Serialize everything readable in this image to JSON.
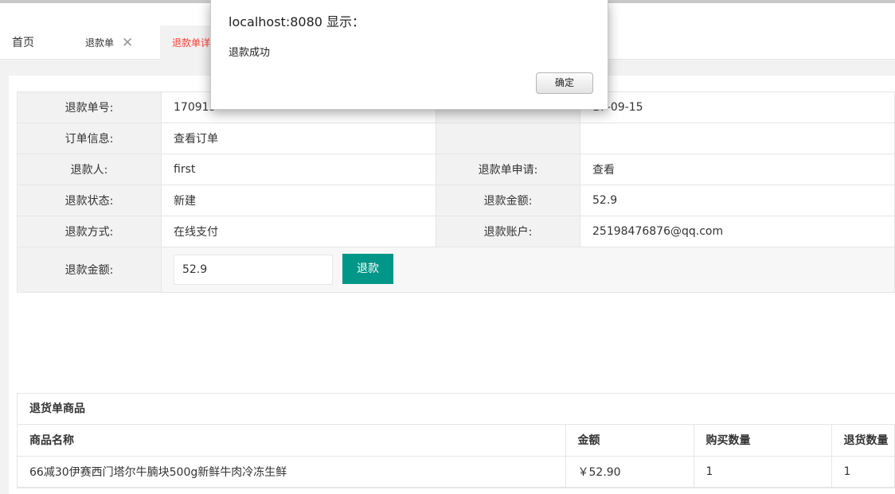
{
  "tabs": {
    "home": "首页",
    "refund_list": "退款单",
    "refund_detail": "退款单详",
    "close_glyph": "✕"
  },
  "info": {
    "refund_no_label": "退款单号:",
    "refund_no_value": "170915",
    "created_label": "",
    "created_value": "17-09-15",
    "order_info_label": "订单信息:",
    "order_info_value": "查看订单",
    "refunder_label": "退款人:",
    "refunder_value": "first",
    "apply_label": "退款单申请:",
    "apply_value": "查看",
    "status_label": "退款状态:",
    "status_value": "新建",
    "amount_label": "退款金额:",
    "amount_value": "52.9",
    "method_label": "退款方式:",
    "method_value": "在线支付",
    "account_label": "退款账户:",
    "account_value": "25198476876@qq.com"
  },
  "refund_form": {
    "amount_label": "退款金额:",
    "amount_input": "52.9",
    "button_label": "退款"
  },
  "goods": {
    "title": "退货单商品",
    "columns": [
      "商品名称",
      "金额",
      "购买数量",
      "退货数量"
    ],
    "rows": [
      {
        "name": "66减30伊赛西门塔尔牛腩块500g新鲜牛肉冷冻生鲜",
        "price": "￥52.90",
        "buy_qty": "1",
        "return_qty": "1"
      }
    ]
  },
  "dialog": {
    "title": "localhost:8080 显示：",
    "message": "退款成功",
    "ok_label": "确定"
  }
}
